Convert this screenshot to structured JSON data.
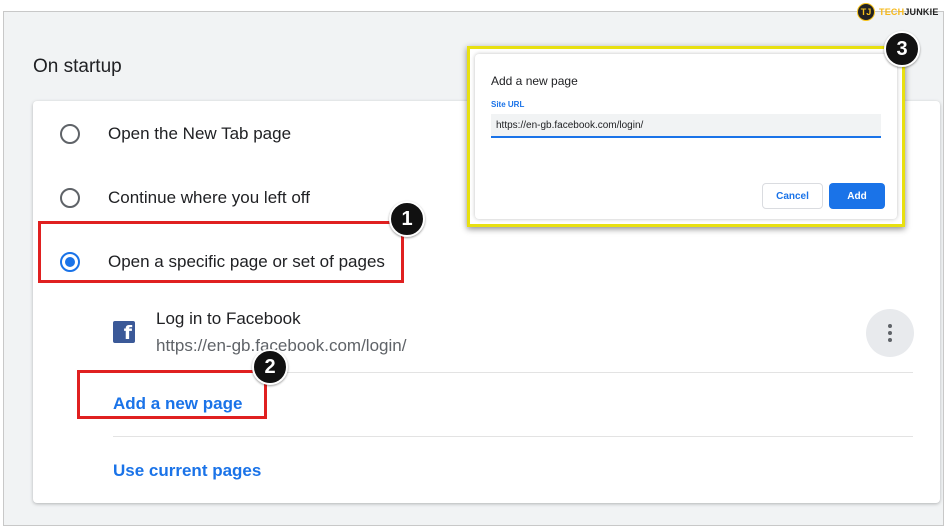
{
  "section": {
    "title": "On startup"
  },
  "startup_options": [
    {
      "label": "Open the New Tab page",
      "checked": false
    },
    {
      "label": "Continue where you left off",
      "checked": false
    },
    {
      "label": "Open a specific page or set of pages",
      "checked": true
    }
  ],
  "pages": [
    {
      "name": "Log in to Facebook",
      "url": "https://en-gb.facebook.com/login/",
      "icon": "facebook-icon"
    }
  ],
  "links": {
    "add_page": "Add a new page",
    "use_current": "Use current pages"
  },
  "dialog": {
    "title": "Add a new page",
    "field_label": "Site URL",
    "field_value": "https://en-gb.facebook.com/login/",
    "cancel_label": "Cancel",
    "add_label": "Add"
  },
  "steps": [
    "1",
    "2",
    "3"
  ],
  "watermark": {
    "logo": "TJ",
    "part1": "TECH",
    "part2": "JUNKIE"
  },
  "colors": {
    "accent": "#1a73e8",
    "highlight_red": "#e02020",
    "highlight_yellow": "#e8e010",
    "facebook": "#3b5998"
  }
}
